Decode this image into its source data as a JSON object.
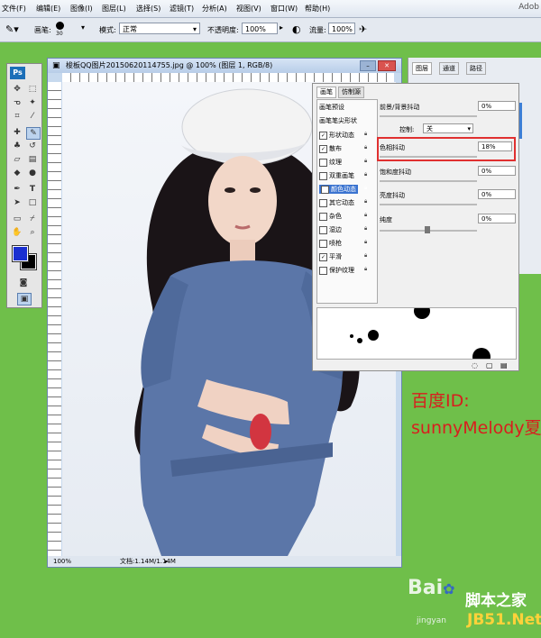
{
  "menu": {
    "items": [
      "文件(F)",
      "编辑(E)",
      "图像(I)",
      "图层(L)",
      "选择(S)",
      "滤镜(T)",
      "分析(A)",
      "视图(V)",
      "窗口(W)",
      "帮助(H)"
    ],
    "app_title": "Adob"
  },
  "options_bar": {
    "brush_label": "画笔:",
    "brush_size": "30",
    "mode_label": "模式:",
    "mode_value": "正常",
    "opacity_label": "不透明度:",
    "opacity_value": "100%",
    "flow_label": "流量:",
    "flow_value": "100%"
  },
  "document": {
    "title": "梭板QQ图片20150620114755.jpg @ 100% (图层 1, RGB/8)",
    "zoom": "100%",
    "doc_info": "文档:1.14M/1.14M"
  },
  "brush_panel": {
    "tabs": [
      "画笔",
      "仿制源"
    ],
    "preset_label": "画笔预设",
    "tip_shape_label": "画笔笔尖形状",
    "options": [
      {
        "label": "形状动态",
        "checked": true,
        "selected": false
      },
      {
        "label": "散布",
        "checked": true,
        "selected": false
      },
      {
        "label": "纹理",
        "checked": false,
        "selected": false
      },
      {
        "label": "双重画笔",
        "checked": false,
        "selected": false
      },
      {
        "label": "颜色动态",
        "checked": true,
        "selected": true
      },
      {
        "label": "其它动态",
        "checked": false,
        "selected": false
      },
      {
        "label": "杂色",
        "checked": false,
        "selected": false
      },
      {
        "label": "湿边",
        "checked": false,
        "selected": false
      },
      {
        "label": "喷枪",
        "checked": false,
        "selected": false
      },
      {
        "label": "平滑",
        "checked": true,
        "selected": false
      },
      {
        "label": "保护纹理",
        "checked": false,
        "selected": false
      }
    ],
    "fg_bg_jitter_label": "前景/背景抖动",
    "fg_bg_jitter_value": "0%",
    "control_label": "控制:",
    "control_value": "关",
    "hue_jitter_label": "色相抖动",
    "hue_jitter_value": "18%",
    "saturation_jitter_label": "饱和度抖动",
    "saturation_jitter_value": "0%",
    "brightness_jitter_label": "亮度抖动",
    "brightness_jitter_value": "0%",
    "purity_label": "纯度",
    "purity_value": "0%"
  },
  "right_panel": {
    "tabs": [
      "图层",
      "通道",
      "路径"
    ]
  },
  "annotation": {
    "line1": "百度ID:",
    "line2": "sunnyMelody夏"
  },
  "watermarks": {
    "baidu": "Bai",
    "jingyan": "jingyan",
    "site_cn": "脚本之家",
    "site_en": "JB51.Net"
  },
  "colors": {
    "foreground": "#1a2fd0",
    "background": "#000000",
    "highlight_box": "#e03030",
    "window_bg": "#6fbf4a"
  }
}
